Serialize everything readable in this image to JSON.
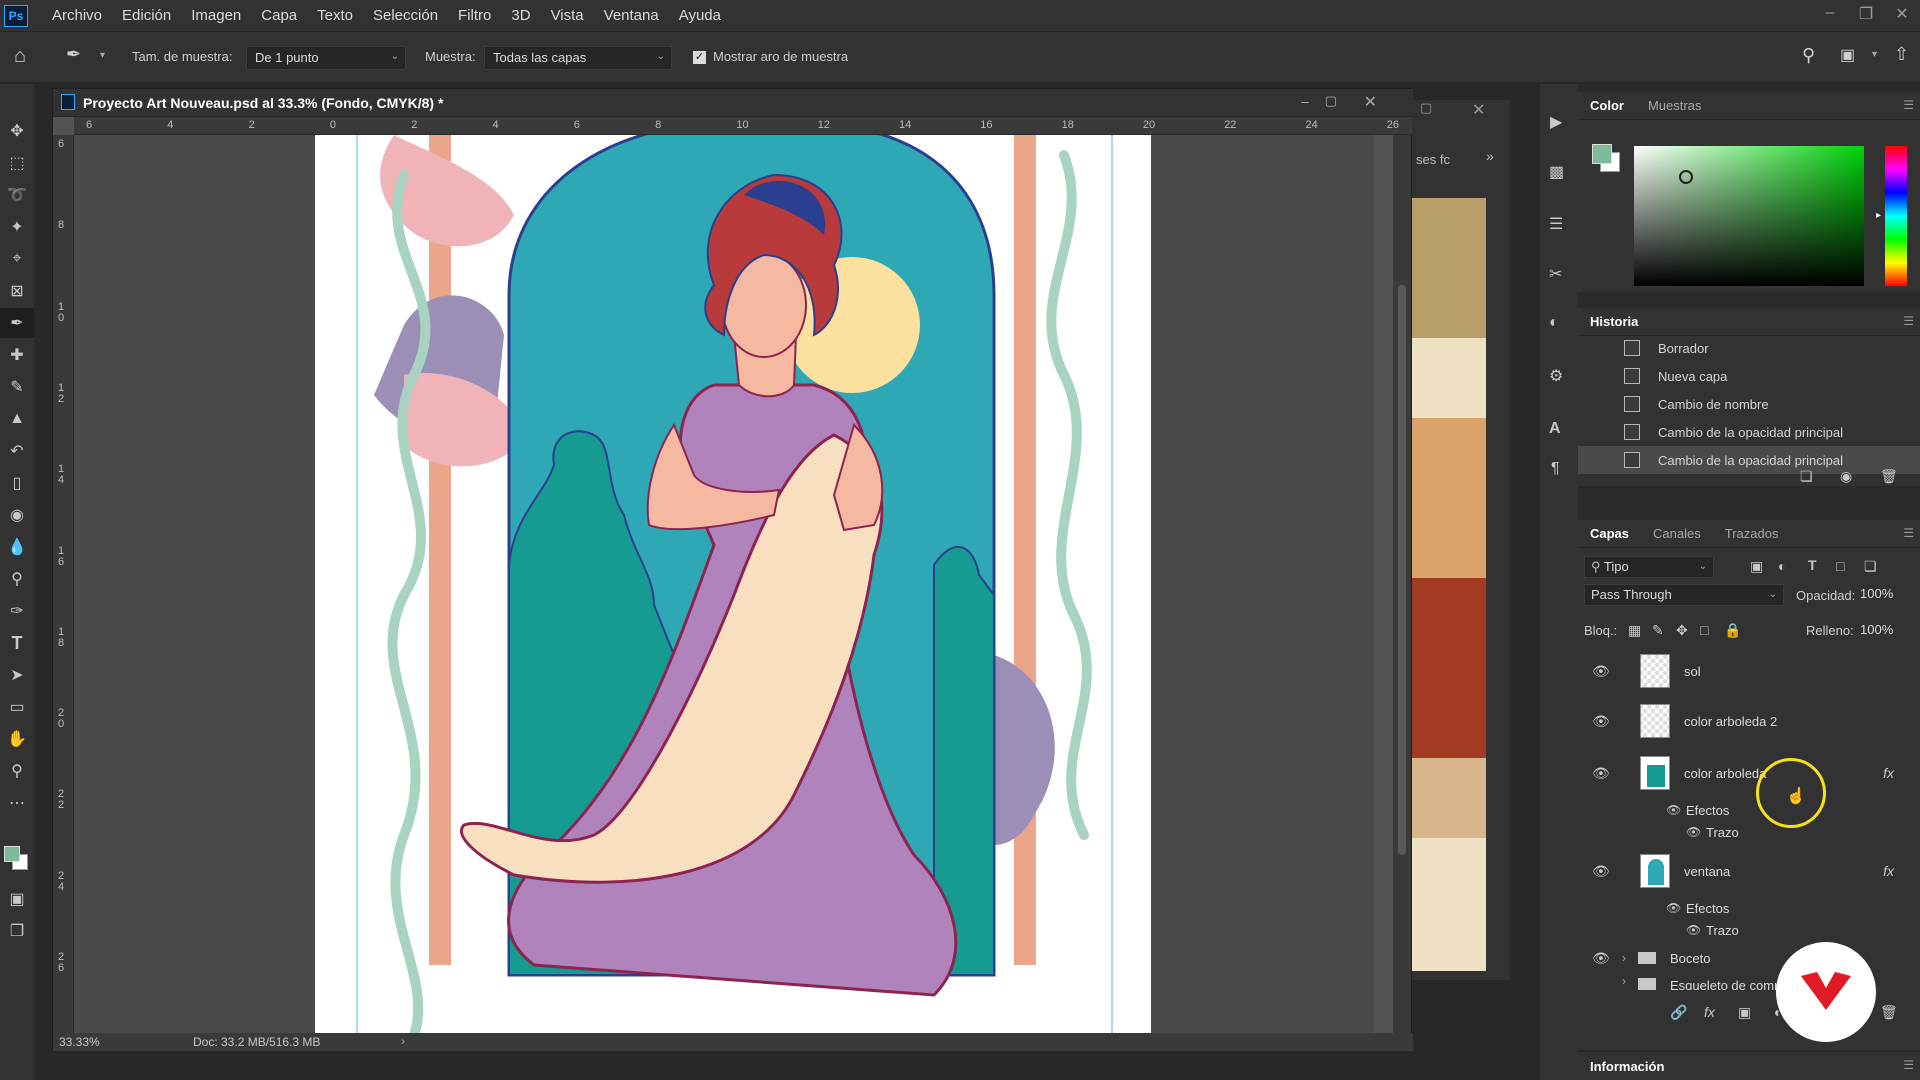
{
  "menubar": {
    "logo": "Ps",
    "items": [
      "Archivo",
      "Edición",
      "Imagen",
      "Capa",
      "Texto",
      "Selección",
      "Filtro",
      "3D",
      "Vista",
      "Ventana",
      "Ayuda"
    ]
  },
  "options": {
    "sample_size_label": "Tam. de muestra:",
    "sample_size_value": "De 1 punto",
    "sample_label": "Muestra:",
    "sample_value": "Todas las capas",
    "show_ring_label": "Mostrar aro de muestra",
    "show_ring_checked": true
  },
  "document": {
    "title": "Proyecto Art Nouveau.psd al 33.3% (Fondo, CMYK/8) *",
    "zoom": "33.33%",
    "doc_info": "Doc: 33.2 MB/516.3 MB",
    "ruler_top": [
      "6",
      "4",
      "2",
      "0",
      "2",
      "4",
      "6",
      "8",
      "10",
      "12",
      "14",
      "16",
      "18",
      "20",
      "22",
      "24",
      "26"
    ],
    "ruler_left": [
      "6",
      "8",
      "1\n0",
      "1\n2",
      "1\n4",
      "1\n6",
      "1\n8",
      "2\n0",
      "2\n2",
      "2\n4",
      "2\n6"
    ]
  },
  "mid_panel": {
    "tab_label": "ses fc"
  },
  "color_panel": {
    "tabs": [
      "Color",
      "Muestras"
    ],
    "foreground": "#7dba9c",
    "background": "#ffffff"
  },
  "history_panel": {
    "title": "Historia",
    "items": [
      "Borrador",
      "Nueva capa",
      "Cambio de nombre",
      "Cambio de la opacidad principal",
      "Cambio de la opacidad principal"
    ]
  },
  "layers_panel": {
    "tabs": [
      "Capas",
      "Canales",
      "Trazados"
    ],
    "filter_label": "Tipo",
    "blend_mode": "Pass Through",
    "opacity_label": "Opacidad:",
    "opacity_value": "100%",
    "lock_label": "Bloq.:",
    "fill_label": "Relleno:",
    "fill_value": "100%",
    "layers": [
      {
        "name": "sol"
      },
      {
        "name": "color arboleda 2"
      },
      {
        "name": "color arboleda",
        "effects_label": "Efectos",
        "effect": "Trazo",
        "fx": "fx"
      },
      {
        "name": "ventana",
        "effects_label": "Efectos",
        "effect": "Trazo",
        "fx": "fx"
      },
      {
        "name": "Boceto"
      },
      {
        "name": "Esqueleto de comp"
      }
    ]
  },
  "info_panel": {
    "title": "Información"
  },
  "colors": {
    "teal": "#2fa8b5",
    "teal_dark": "#159b91",
    "purple": "#b183bd",
    "cream": "#f8dfc0",
    "moon": "#fce0a0",
    "peach": "#eaa58a",
    "sage": "#a7d3c0",
    "outline": "#8c2350",
    "hair": "#b83a3a"
  }
}
